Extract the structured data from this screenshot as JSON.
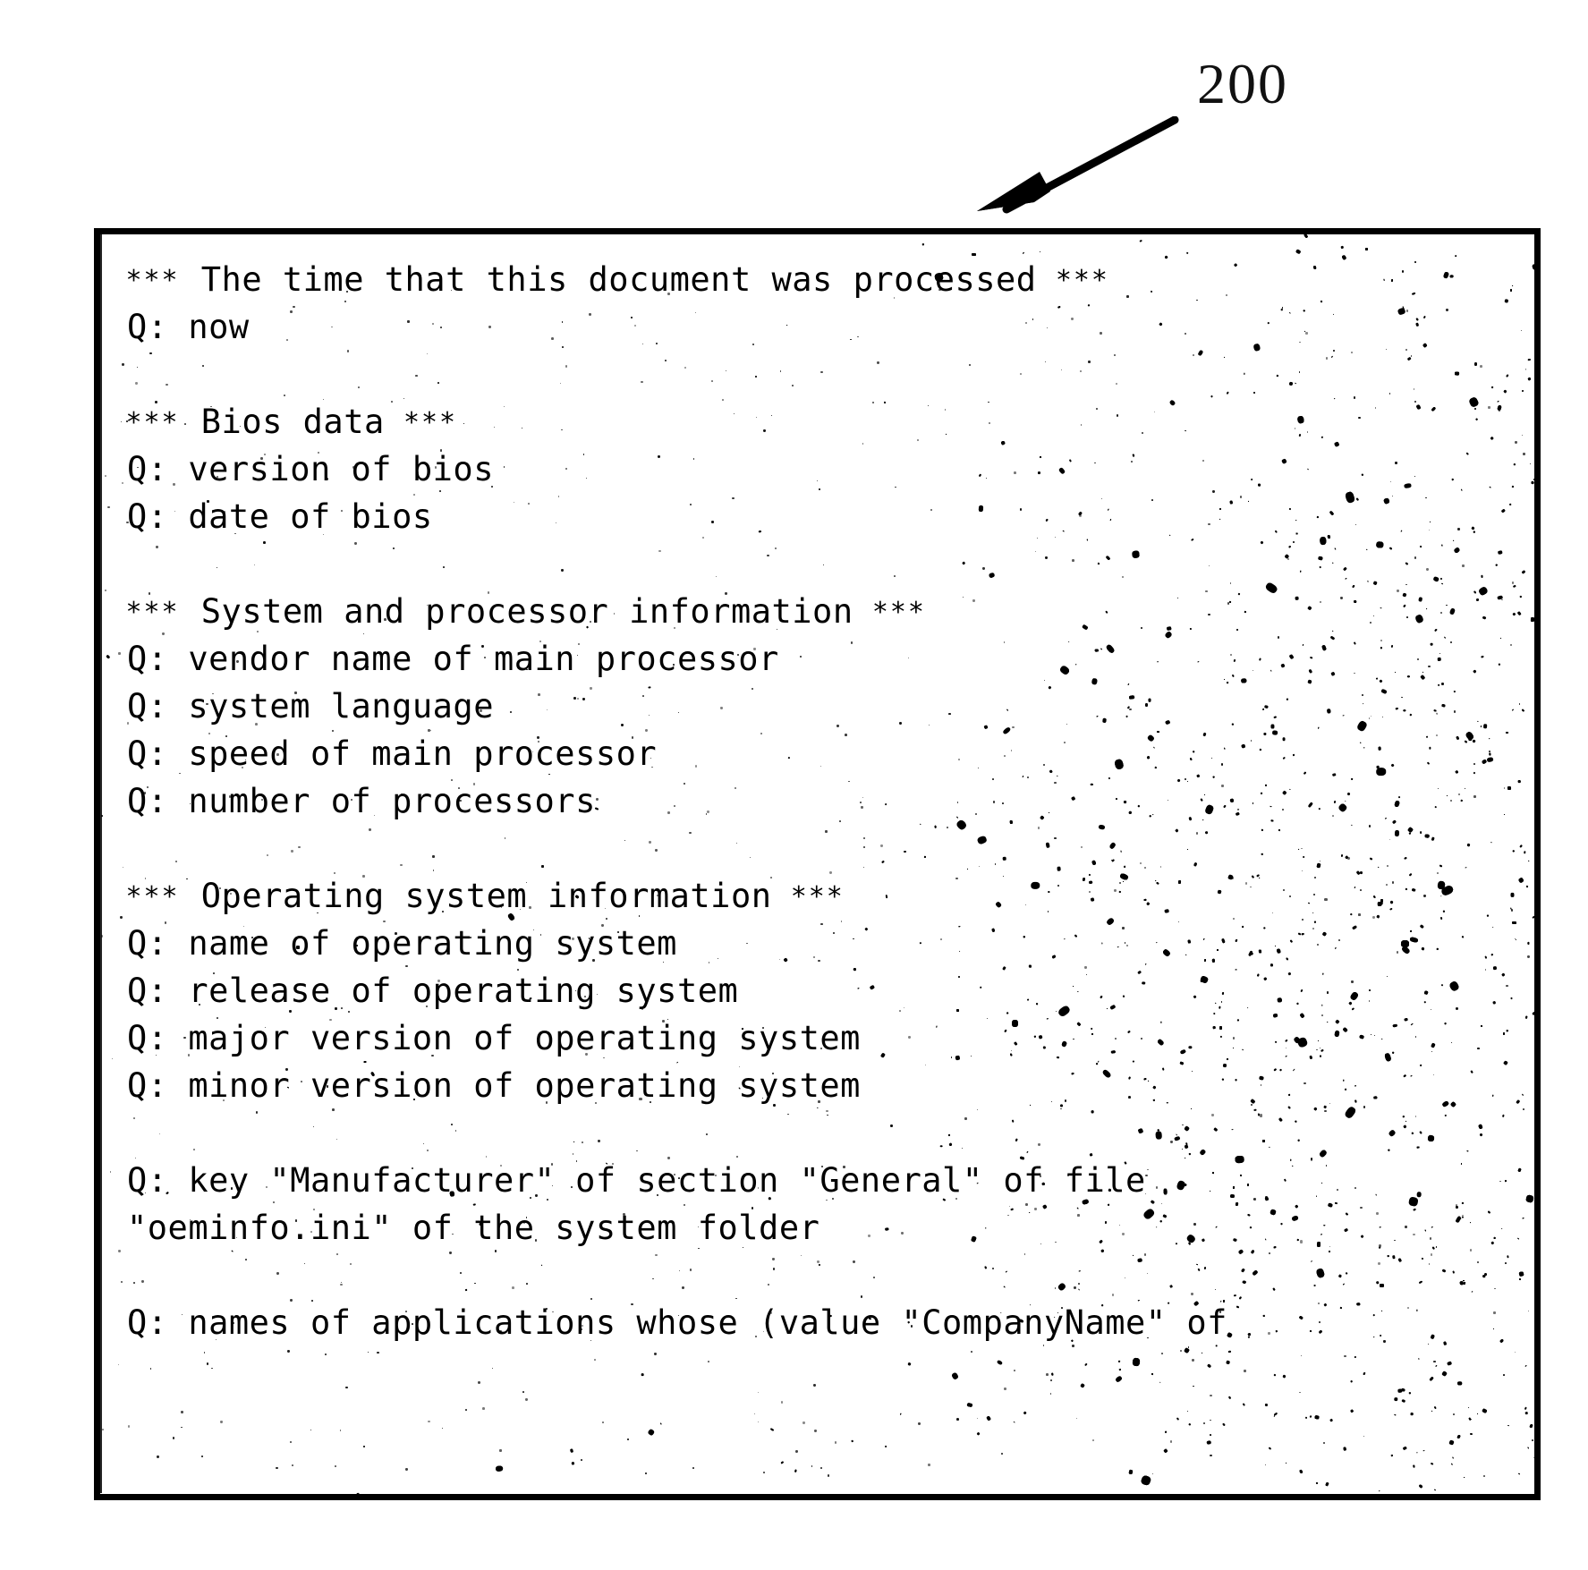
{
  "figure": {
    "reference_numeral": "200",
    "arrow_icon": "leader-arrow-icon",
    "description": "Patent figure: screen listing of relevance-clause questions"
  },
  "listing": {
    "lines": [
      {
        "type": "heading",
        "stars_left": "***",
        "text": " The time that this document was processed ",
        "stars_right": "***"
      },
      {
        "type": "query",
        "text": "Q: now"
      },
      {
        "type": "blank",
        "text": ""
      },
      {
        "type": "heading",
        "stars_left": "***",
        "text": " Bios data ",
        "stars_right": "***"
      },
      {
        "type": "query",
        "text": "Q: version of bios"
      },
      {
        "type": "query",
        "text": "Q: date of bios"
      },
      {
        "type": "blank",
        "text": ""
      },
      {
        "type": "heading",
        "stars_left": "***",
        "text": " System and processor information ",
        "stars_right": "***"
      },
      {
        "type": "query",
        "text": "Q: vendor name of main processor"
      },
      {
        "type": "query",
        "text": "Q: system language"
      },
      {
        "type": "query",
        "text": "Q: speed of main processor"
      },
      {
        "type": "query",
        "text": "Q: number of processors"
      },
      {
        "type": "blank",
        "text": ""
      },
      {
        "type": "heading",
        "stars_left": "***",
        "text": " Operating system information ",
        "stars_right": "***"
      },
      {
        "type": "query",
        "text": "Q: name of operating system"
      },
      {
        "type": "query",
        "text": "Q: release of operating system"
      },
      {
        "type": "query",
        "text": "Q: major version of operating system"
      },
      {
        "type": "query",
        "text": "Q: minor version of operating system"
      },
      {
        "type": "blank",
        "text": ""
      },
      {
        "type": "query",
        "text": "Q: key \"Manufacturer\" of section \"General\" of file"
      },
      {
        "type": "query",
        "text": "\"oeminfo.ini\" of the system folder"
      },
      {
        "type": "blank",
        "text": ""
      },
      {
        "type": "query",
        "text": "Q: names of applications whose (value \"CompanyName\" of"
      }
    ]
  },
  "colors": {
    "ink": "#000000",
    "paper": "#ffffff"
  }
}
